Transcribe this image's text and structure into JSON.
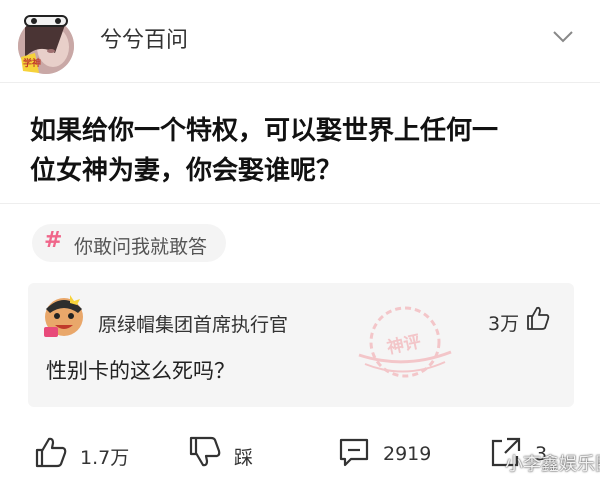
{
  "header": {
    "username": "兮兮百问",
    "avatar_badge": "学神"
  },
  "question": {
    "line1": "如果给你一个特权，可以娶世界上任何一",
    "line2": "位女神为妻，你会娶谁呢？"
  },
  "topic": {
    "hash": "#",
    "label": "你敢问我就敢答"
  },
  "comment": {
    "username": "原绿帽集团首席执行官",
    "likes": "3万",
    "text": "性别卡的这么死吗？",
    "stamp_text": "神评"
  },
  "actions": {
    "like_count": "1.7万",
    "dislike_label": "踩",
    "comment_count": "2919",
    "share_count": "3"
  },
  "watermark": "小李鑫娱乐圈",
  "colors": {
    "accent": "#f0668a",
    "card_bg": "#f5f5f5",
    "stamp": "#f3a0a6"
  }
}
